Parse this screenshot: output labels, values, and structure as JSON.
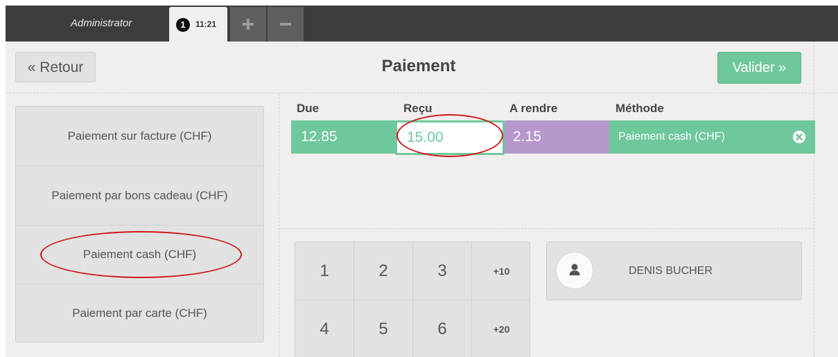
{
  "topbar": {
    "user": "Administrator",
    "order_tab": {
      "badge": "1",
      "time": "11:21"
    },
    "add_order_symbol": "+",
    "remove_order_symbol": "−"
  },
  "header": {
    "back_label": "« Retour",
    "title": "Paiement",
    "validate_label": "Valider »"
  },
  "payment_methods": [
    "Paiement sur facture (CHF)",
    "Paiement par bons cadeau (CHF)",
    "Paiement cash (CHF)",
    "Paiement par carte (CHF)"
  ],
  "paymentlines": {
    "headers": {
      "due": "Due",
      "received": "Reçu",
      "change": "A rendre",
      "method": "Méthode"
    },
    "row": {
      "due": "12.85",
      "received": "15.00",
      "change": "2.15",
      "method": "Paiement cash (CHF)"
    }
  },
  "numpad": {
    "keys": [
      "1",
      "2",
      "3",
      "+10",
      "4",
      "5",
      "6",
      "+20"
    ]
  },
  "customer": {
    "name": "DENIS BUCHER"
  },
  "colors": {
    "accent_green": "#6ec89b",
    "change_purple": "#b698cd",
    "annotation_red": "#d01818",
    "topbar": "#3c3c3c"
  },
  "icons": [
    "plus-icon",
    "minus-icon",
    "remove-line-icon",
    "user-icon"
  ]
}
